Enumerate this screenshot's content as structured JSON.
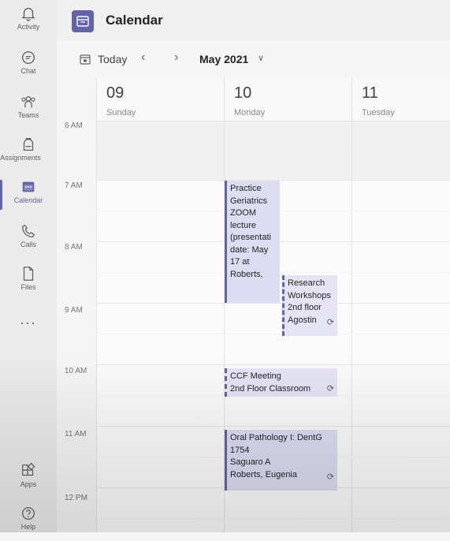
{
  "rail": {
    "items": [
      {
        "label": "Activity",
        "icon": "bell-icon"
      },
      {
        "label": "Chat",
        "icon": "chat-icon"
      },
      {
        "label": "Teams",
        "icon": "teams-icon"
      },
      {
        "label": "Assignments",
        "icon": "backpack-icon"
      },
      {
        "label": "Calendar",
        "icon": "calendar-icon",
        "active": true
      },
      {
        "label": "Calls",
        "icon": "phone-icon"
      },
      {
        "label": "Files",
        "icon": "file-icon"
      },
      {
        "label": "Apps",
        "icon": "apps-icon"
      },
      {
        "label": "Help",
        "icon": "help-icon"
      }
    ],
    "more": "..."
  },
  "header": {
    "title": "Calendar"
  },
  "toolbar": {
    "today": "Today",
    "prev": "‹",
    "next": "›",
    "month": "May 2021",
    "caret": "∨"
  },
  "days": [
    {
      "num": "09",
      "name": "Sunday"
    },
    {
      "num": "10",
      "name": "Monday"
    },
    {
      "num": "11",
      "name": "Tuesday"
    }
  ],
  "times": [
    "6 AM",
    "7 AM",
    "8 AM",
    "9 AM",
    "10 AM",
    "11 AM",
    "12 PM"
  ],
  "events": [
    {
      "lines": [
        "Practice",
        "Geriatrics",
        "ZOOM",
        "lecture",
        "(presentati",
        "date: May",
        "17 at",
        "Roberts,"
      ],
      "recurring": false,
      "tentative": false
    },
    {
      "lines": [
        "Research",
        "Workshops",
        "2nd floor",
        "Agostin"
      ],
      "recurring": true,
      "tentative": true
    },
    {
      "lines": [
        "CCF Meeting",
        "2nd Floor Classroom"
      ],
      "recurring": true,
      "tentative": true
    },
    {
      "lines": [
        "Oral Pathology I: DentG",
        "1754",
        "Saguaro A",
        "Roberts, Eugenia"
      ],
      "recurring": true,
      "tentative": false
    }
  ],
  "colors": {
    "accent": "#6264a7",
    "event_bg": "#dcdcf3"
  }
}
